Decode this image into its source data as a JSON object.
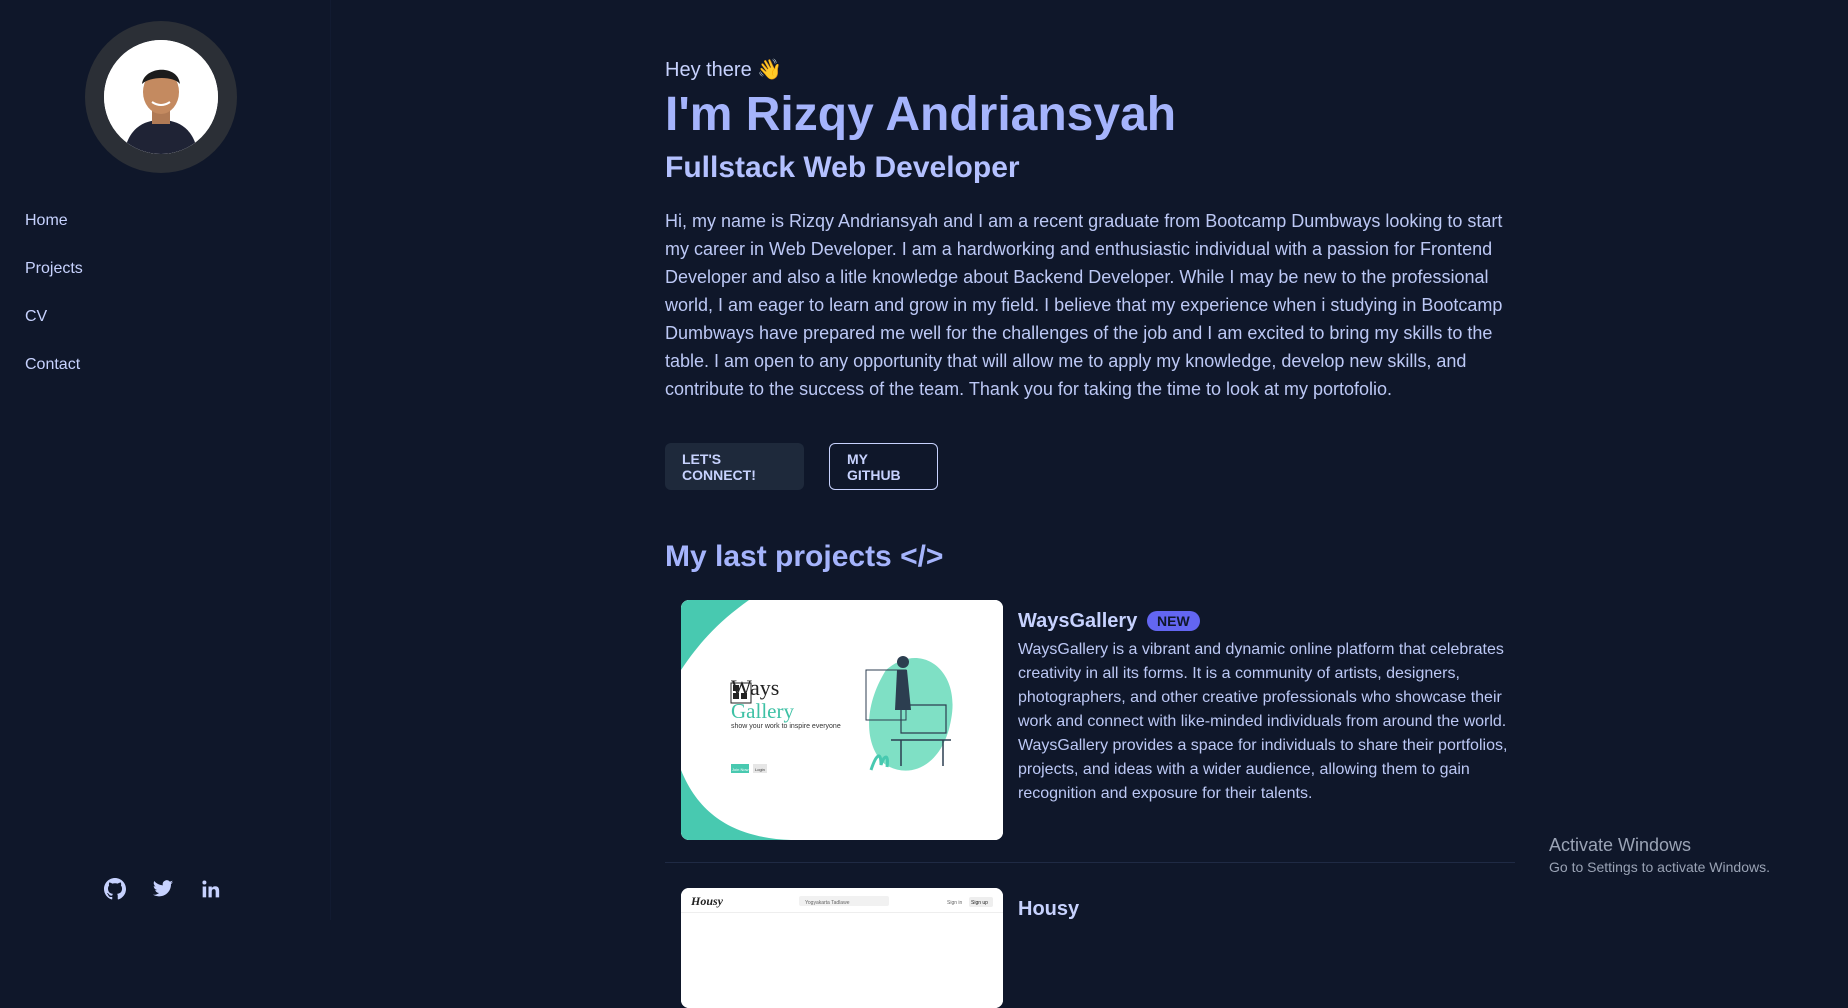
{
  "sidebar": {
    "nav": [
      "Home",
      "Projects",
      "CV",
      "Contact"
    ],
    "socials": [
      "github-icon",
      "twitter-icon",
      "linkedin-icon"
    ]
  },
  "hero": {
    "greeting": "Hey there 👋",
    "name": "I'm Rizqy Andriansyah",
    "role": "Fullstack Web Developer",
    "bio": "Hi, my name is Rizqy Andriansyah and I am a recent graduate from Bootcamp Dumbways looking to start my career in Web Developer. I am a hardworking and enthusiastic individual with a passion for Frontend Developer and also a litle knowledge about Backend Developer. While I may be new to the professional world, I am eager to learn and grow in my field. I believe that my experience when i studying in Bootcamp Dumbways have prepared me well for the challenges of the job and I am excited to bring my skills to the table. I am open to any opportunity that will allow me to apply my knowledge, develop new skills, and contribute to the success of the team. Thank you for taking the time to look at my portofolio.",
    "connect_label": "LET'S CONNECT!",
    "github_label": "MY GITHUB"
  },
  "projects": {
    "title": "My last projects </>",
    "items": [
      {
        "title": "WaysGallery",
        "badge": "NEW",
        "description": "WaysGallery is a vibrant and dynamic online platform that celebrates creativity in all its forms. It is a community of artists, designers, photographers, and other creative professionals who showcase their work and connect with like-minded individuals from around the world. WaysGallery provides a space for individuals to share their portfolios, projects, and ideas with a wider audience, allowing them to gain recognition and exposure for their talents.",
        "thumb": {
          "brand_top": "Ways",
          "brand_bottom": "Gallery",
          "tagline": "show your work to inspire everyone",
          "btn1": "Join Now",
          "btn2": "Login"
        }
      },
      {
        "title": "Housy",
        "thumb": {
          "logo": "Housy",
          "search": "Yogyakarta Tadlawe",
          "signin": "Sign in",
          "signup": "Sign up"
        }
      }
    ]
  },
  "watermark": {
    "line1": "Activate Windows",
    "line2": "Go to Settings to activate Windows."
  },
  "colors": {
    "background": "#0f172a",
    "accent": "#a5b4fc",
    "badge": "#6366f1",
    "teal": "#3ec1a5"
  }
}
